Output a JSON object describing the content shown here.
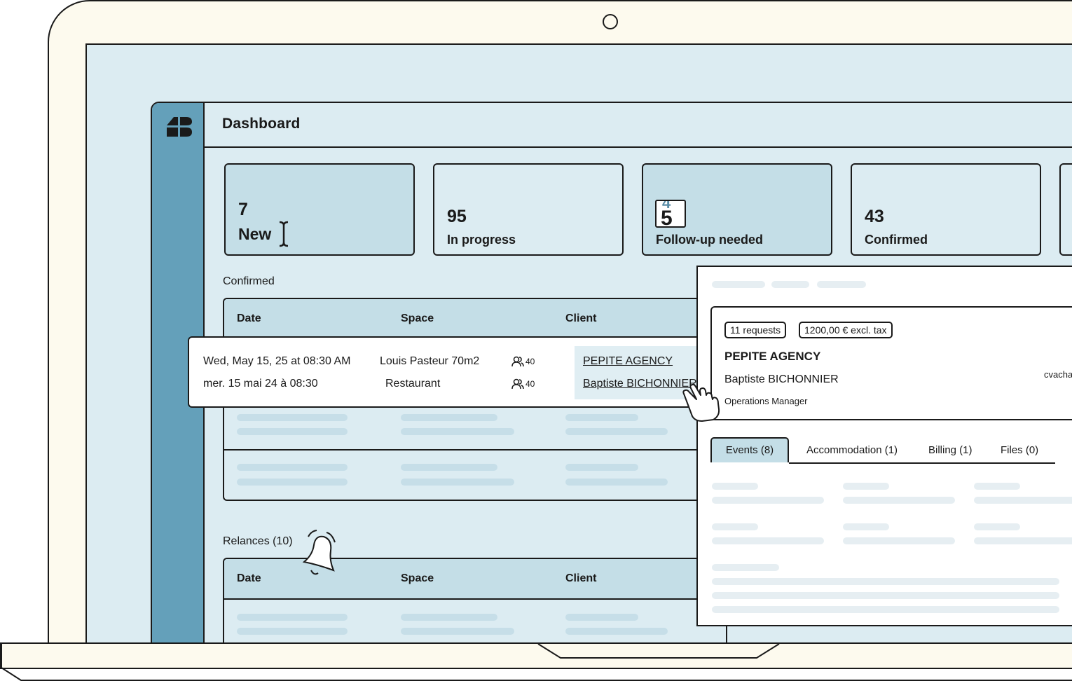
{
  "app": {
    "title": "Dashboard"
  },
  "stats": [
    {
      "value": "7",
      "label": "New"
    },
    {
      "value": "95",
      "label": "In progress"
    },
    {
      "value": "5",
      "value_prev": "4",
      "label": "Follow-up needed"
    },
    {
      "value": "43",
      "label": "Confirmed"
    }
  ],
  "confirmed": {
    "title": "Confirmed",
    "columns": [
      "Date",
      "Space",
      "Client"
    ],
    "row": {
      "date_en": "Wed, May 15, 25 at 08:30 AM",
      "date_fr": "mer. 15 mai 24 à 08:30",
      "space": "Louis Pasteur 70m2",
      "space_type": "Restaurant",
      "capacity_1": "40",
      "capacity_2": "40",
      "client_company": "PEPITE AGENCY",
      "client_name": "Baptiste BICHONNIER"
    }
  },
  "relances": {
    "title": "Relances (10)",
    "columns": [
      "Date",
      "Space",
      "Client"
    ]
  },
  "detail": {
    "badge_requests": "11 requests",
    "badge_amount": "1200,00 € excl. tax",
    "company": "PEPITE AGENCY",
    "contact": "Baptiste BICHONNIER",
    "role": "Operations Manager",
    "extra": "cvacha",
    "tabs": [
      "Events (8)",
      "Accommodation (1)",
      "Billing (1)",
      "Files (0)"
    ]
  },
  "colors": {
    "sidebar": "#64a0ba",
    "screen": "#dcecf2",
    "card_active": "#c4dee7",
    "frame": "#fdfaee"
  }
}
